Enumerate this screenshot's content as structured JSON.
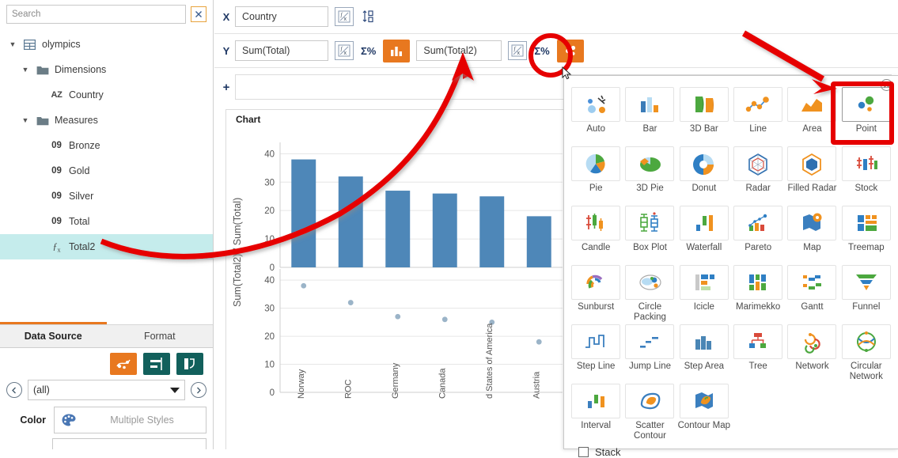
{
  "left_panel": {
    "search": {
      "placeholder": "Search",
      "value": ""
    },
    "clear_button_icon": "x-box-icon",
    "tree": [
      {
        "label": "olympics",
        "level": 1,
        "icon": "table-icon",
        "expanded": true,
        "selected": false
      },
      {
        "label": "Dimensions",
        "level": 2,
        "icon": "folder-icon",
        "expanded": true,
        "selected": false
      },
      {
        "label": "Country",
        "level": 3,
        "icon": "az-icon",
        "expanded": null,
        "selected": false
      },
      {
        "label": "Measures",
        "level": 2,
        "icon": "folder-icon",
        "expanded": true,
        "selected": false
      },
      {
        "label": "Bronze",
        "level": 3,
        "icon": "09-icon",
        "expanded": null,
        "selected": false
      },
      {
        "label": "Gold",
        "level": 3,
        "icon": "09-icon",
        "expanded": null,
        "selected": false
      },
      {
        "label": "Silver",
        "level": 3,
        "icon": "09-icon",
        "expanded": null,
        "selected": false
      },
      {
        "label": "Total",
        "level": 3,
        "icon": "09-icon",
        "expanded": null,
        "selected": false
      },
      {
        "label": "Total2",
        "level": 3,
        "icon": "fx-icon",
        "expanded": null,
        "selected": true
      }
    ],
    "tabs": [
      {
        "label": "Data Source",
        "active": true
      },
      {
        "label": "Format",
        "active": false
      }
    ],
    "tools": [
      {
        "name": "scatter-style-button",
        "icon": "scatter-icon",
        "color": "#e8781f"
      },
      {
        "name": "align-button",
        "icon": "align-icon",
        "color": "#12605c"
      },
      {
        "name": "rotate-button",
        "icon": "rotate-icon",
        "color": "#12605c"
      }
    ],
    "selector": {
      "prev_icon": "chevron-left-icon",
      "value": "(all)",
      "next_icon": "chevron-right-icon"
    },
    "color_row": {
      "label": "Color",
      "icon": "palette-icon",
      "placeholder": "Multiple Styles"
    }
  },
  "binding_bar": {
    "rows": [
      {
        "key": "X",
        "items": [
          {
            "type": "pill",
            "name": "x-field-country",
            "label": "Country",
            "fx_icon": "fx-box-icon"
          },
          {
            "type": "icon",
            "name": "sort-button",
            "icon": "sort-09-icon"
          }
        ]
      },
      {
        "key": "Y",
        "items": [
          {
            "type": "pill",
            "name": "y-field-total",
            "label": "Sum(Total)",
            "fx_icon": "fx-box-icon"
          },
          {
            "type": "sigma",
            "name": "y-total-percent-button",
            "label": "Σ%"
          },
          {
            "type": "chip",
            "name": "y-total-charttype-button",
            "icon": "bar-chart-icon",
            "color": "#e8781f"
          },
          {
            "type": "pill",
            "name": "y-field-total2",
            "label": "Sum(Total2)",
            "fx_icon": "fx-box-icon"
          },
          {
            "type": "sigma",
            "name": "y-total2-percent-button",
            "label": "Σ%"
          },
          {
            "type": "chip",
            "name": "y-total2-charttype-button",
            "icon": "point-chart-icon",
            "color": "#e8781f",
            "highlighted": true
          }
        ]
      }
    ],
    "add_row": {
      "plus_label": "+"
    }
  },
  "chart_data": {
    "type": "bar",
    "title": "Chart",
    "xlabel": "",
    "ylabel": "Sum(Total2) / Sum(Total)",
    "categories": [
      "Norway",
      "ROC",
      "Germany",
      "Canada",
      "d States of America",
      "Austria"
    ],
    "panels": [
      {
        "name": "Sum(Total)",
        "type": "bar",
        "ylabel": "Sum(Total)",
        "values": [
          38,
          32,
          27,
          26,
          25,
          18
        ],
        "ylim": [
          0,
          44
        ],
        "ticks": [
          0,
          10,
          20,
          30,
          40
        ],
        "color": "#4e87b8",
        "grid": true
      },
      {
        "name": "Sum(Total2)",
        "type": "scatter",
        "ylabel": "Sum(Total2)",
        "values": [
          38,
          32,
          27,
          26,
          25,
          18
        ],
        "ylim": [
          0,
          44
        ],
        "ticks": [
          0,
          10,
          20,
          30,
          40
        ],
        "color": "#9bb4c8",
        "grid": true
      }
    ],
    "legend": null
  },
  "picker": {
    "close_icon": "close-circle-icon",
    "items": [
      {
        "label": "Auto",
        "icon": "auto-icon",
        "selected": false
      },
      {
        "label": "Bar",
        "icon": "bar-icon",
        "selected": false
      },
      {
        "label": "3D Bar",
        "icon": "3d-bar-icon",
        "selected": false
      },
      {
        "label": "Line",
        "icon": "line-icon",
        "selected": false
      },
      {
        "label": "Area",
        "icon": "area-icon",
        "selected": false
      },
      {
        "label": "Point",
        "icon": "point-icon",
        "selected": true
      },
      {
        "label": "Pie",
        "icon": "pie-icon",
        "selected": false
      },
      {
        "label": "3D Pie",
        "icon": "3d-pie-icon",
        "selected": false
      },
      {
        "label": "Donut",
        "icon": "donut-icon",
        "selected": false
      },
      {
        "label": "Radar",
        "icon": "radar-icon",
        "selected": false
      },
      {
        "label": "Filled Radar",
        "icon": "filled-radar-icon",
        "selected": false
      },
      {
        "label": "Stock",
        "icon": "stock-icon",
        "selected": false
      },
      {
        "label": "Candle",
        "icon": "candle-icon",
        "selected": false
      },
      {
        "label": "Box Plot",
        "icon": "box-plot-icon",
        "selected": false
      },
      {
        "label": "Waterfall",
        "icon": "waterfall-icon",
        "selected": false
      },
      {
        "label": "Pareto",
        "icon": "pareto-icon",
        "selected": false
      },
      {
        "label": "Map",
        "icon": "map-icon",
        "selected": false
      },
      {
        "label": "Treemap",
        "icon": "treemap-icon",
        "selected": false
      },
      {
        "label": "Sunburst",
        "icon": "sunburst-icon",
        "selected": false
      },
      {
        "label": "Circle Packing",
        "icon": "circle-packing-icon",
        "selected": false
      },
      {
        "label": "Icicle",
        "icon": "icicle-icon",
        "selected": false
      },
      {
        "label": "Marimekko",
        "icon": "marimekko-icon",
        "selected": false
      },
      {
        "label": "Gantt",
        "icon": "gantt-icon",
        "selected": false
      },
      {
        "label": "Funnel",
        "icon": "funnel-icon",
        "selected": false
      },
      {
        "label": "Step Line",
        "icon": "step-line-icon",
        "selected": false
      },
      {
        "label": "Jump Line",
        "icon": "jump-line-icon",
        "selected": false
      },
      {
        "label": "Step Area",
        "icon": "step-area-icon",
        "selected": false
      },
      {
        "label": "Tree",
        "icon": "tree-icon",
        "selected": false
      },
      {
        "label": "Network",
        "icon": "network-icon",
        "selected": false
      },
      {
        "label": "Circular Network",
        "icon": "circular-network-icon",
        "selected": false
      },
      {
        "label": "Interval",
        "icon": "interval-icon",
        "selected": false
      },
      {
        "label": "Scatter Contour",
        "icon": "scatter-contour-icon",
        "selected": false
      },
      {
        "label": "Contour Map",
        "icon": "contour-map-icon",
        "selected": false
      }
    ],
    "stack": {
      "label": "Stack",
      "checked": false
    }
  },
  "annotations": {
    "color": "#e60000",
    "shapes": [
      "curved-arrow-to-total2",
      "straight-arrow-to-sum-total2-pill",
      "circle-on-point-chip",
      "arrow-to-point-tile",
      "rect-on-point-tile"
    ]
  }
}
